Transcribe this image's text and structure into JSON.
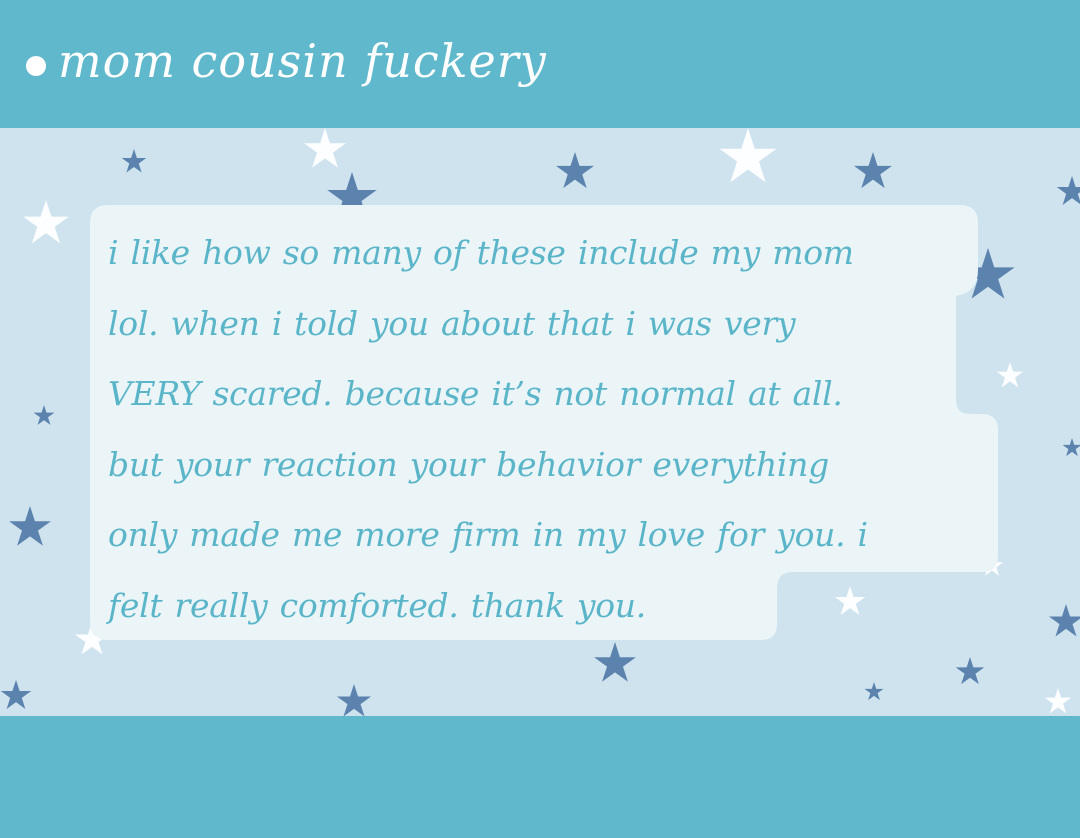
{
  "header": {
    "title": "mom cousin fuckery"
  },
  "note": {
    "lines": [
      "i like how so many of these include my mom",
      "lol. when i told you about that i was very",
      "VERY scared. because it’s not normal at all.",
      "but your reaction your behavior everything",
      "only made me more firm in my love for you. i",
      "felt really comforted. thank you."
    ]
  },
  "colors": {
    "band": "#5fb8cc",
    "sky": "#cfe3ef",
    "bubble": "#ebf5f8",
    "text": "#5bb5c8",
    "star_dark": "#5b83ad",
    "star_light": "#ffffff"
  },
  "icons": {
    "bullet": "dot-icon",
    "background": "star-icon"
  }
}
